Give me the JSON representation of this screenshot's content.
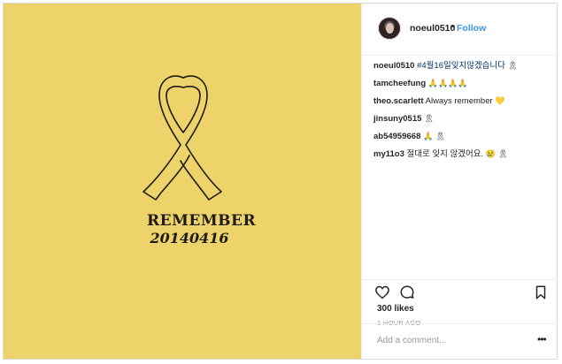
{
  "post": {
    "image": {
      "remember_text": "REMEMBER",
      "date_text": "20140416",
      "background_color": "#eed36b"
    },
    "header": {
      "username": "noeul0510",
      "separator": "•",
      "follow_label": "Follow"
    },
    "comments": [
      {
        "user": "noeul0510",
        "text": "#4월16일잊지않겠습니다",
        "emoji": "🎗"
      },
      {
        "user": "tamcheefung",
        "text": "",
        "emoji": "🙏🙏🙏🙏"
      },
      {
        "user": "theo.scarlett",
        "text": "Always remember",
        "emoji": "💛"
      },
      {
        "user": "jinsuny0515",
        "text": "",
        "emoji": "🎗"
      },
      {
        "user": "ab54959668",
        "text": "",
        "emoji": "🙏 🎗"
      },
      {
        "user": "my11o3",
        "text": "절대로 잊지 않겠어요.",
        "emoji": "😢 🎗"
      }
    ],
    "likes": "300 likes",
    "time_ago": "1 HOUR AGO",
    "add_comment_placeholder": "Add a comment...",
    "more_label": "•••"
  }
}
